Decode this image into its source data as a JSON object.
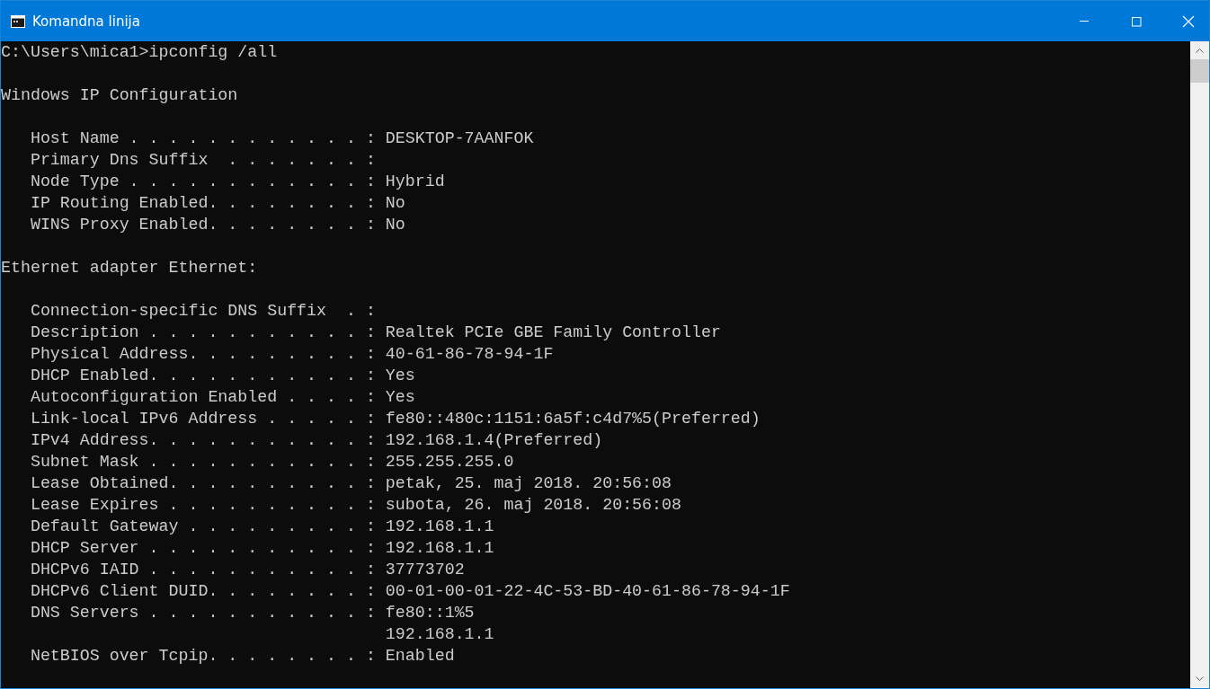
{
  "window": {
    "title": "Komandna linija"
  },
  "console": {
    "lines": [
      {
        "kind": "text",
        "text": "C:\\Users\\mica1>ipconfig /all"
      },
      {
        "kind": "blank"
      },
      {
        "kind": "text",
        "text": "Windows IP Configuration"
      },
      {
        "kind": "blank"
      },
      {
        "kind": "text",
        "text": "   Host Name . . . . . . . . . . . . : DESKTOP-7AANFOK"
      },
      {
        "kind": "text",
        "text": "   Primary Dns Suffix  . . . . . . . :"
      },
      {
        "kind": "text",
        "text": "   Node Type . . . . . . . . . . . . : Hybrid"
      },
      {
        "kind": "text",
        "text": "   IP Routing Enabled. . . . . . . . : No"
      },
      {
        "kind": "text",
        "text": "   WINS Proxy Enabled. . . . . . . . : No"
      },
      {
        "kind": "blank"
      },
      {
        "kind": "text",
        "text": "Ethernet adapter Ethernet:"
      },
      {
        "kind": "blank"
      },
      {
        "kind": "text",
        "text": "   Connection-specific DNS Suffix  . :"
      },
      {
        "kind": "text",
        "text": "   Description . . . . . . . . . . . : Realtek PCIe GBE Family Controller"
      },
      {
        "kind": "text",
        "text": "   Physical Address. . . . . . . . . : 40-61-86-78-94-1F"
      },
      {
        "kind": "text",
        "text": "   DHCP Enabled. . . . . . . . . . . : Yes"
      },
      {
        "kind": "text",
        "text": "   Autoconfiguration Enabled . . . . : Yes"
      },
      {
        "kind": "text",
        "text": "   Link-local IPv6 Address . . . . . : fe80::480c:1151:6a5f:c4d7%5(Preferred)"
      },
      {
        "kind": "text",
        "text": "   IPv4 Address. . . . . . . . . . . : 192.168.1.4(Preferred)"
      },
      {
        "kind": "text",
        "text": "   Subnet Mask . . . . . . . . . . . : 255.255.255.0"
      },
      {
        "kind": "text",
        "text": "   Lease Obtained. . . . . . . . . . : petak, 25. maj 2018. 20:56:08"
      },
      {
        "kind": "text",
        "text": "   Lease Expires . . . . . . . . . . : subota, 26. maj 2018. 20:56:08"
      },
      {
        "kind": "text",
        "text": "   Default Gateway . . . . . . . . . : 192.168.1.1"
      },
      {
        "kind": "text",
        "text": "   DHCP Server . . . . . . . . . . . : 192.168.1.1"
      },
      {
        "kind": "text",
        "text": "   DHCPv6 IAID . . . . . . . . . . . : 37773702"
      },
      {
        "kind": "text",
        "text": "   DHCPv6 Client DUID. . . . . . . . : 00-01-00-01-22-4C-53-BD-40-61-86-78-94-1F"
      },
      {
        "kind": "text",
        "text": "   DNS Servers . . . . . . . . . . . : fe80::1%5"
      },
      {
        "kind": "text",
        "text": "                                       192.168.1.1"
      },
      {
        "kind": "text",
        "text": "   NetBIOS over Tcpip. . . . . . . . : Enabled"
      }
    ]
  }
}
